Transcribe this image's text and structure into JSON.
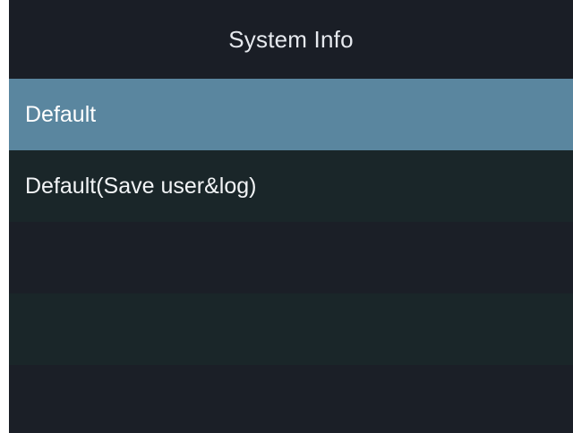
{
  "header": {
    "title": "System Info"
  },
  "menu": {
    "items": [
      {
        "label": "Default",
        "selected": true
      },
      {
        "label": "Default(Save user&log)",
        "selected": false
      },
      {
        "label": "",
        "selected": false
      },
      {
        "label": "",
        "selected": false
      },
      {
        "label": "",
        "selected": false
      }
    ]
  },
  "colors": {
    "background": "#1b1f27",
    "row_alt": "#1a2629",
    "selected": "#5a869f",
    "text": "#f2f4f6"
  }
}
